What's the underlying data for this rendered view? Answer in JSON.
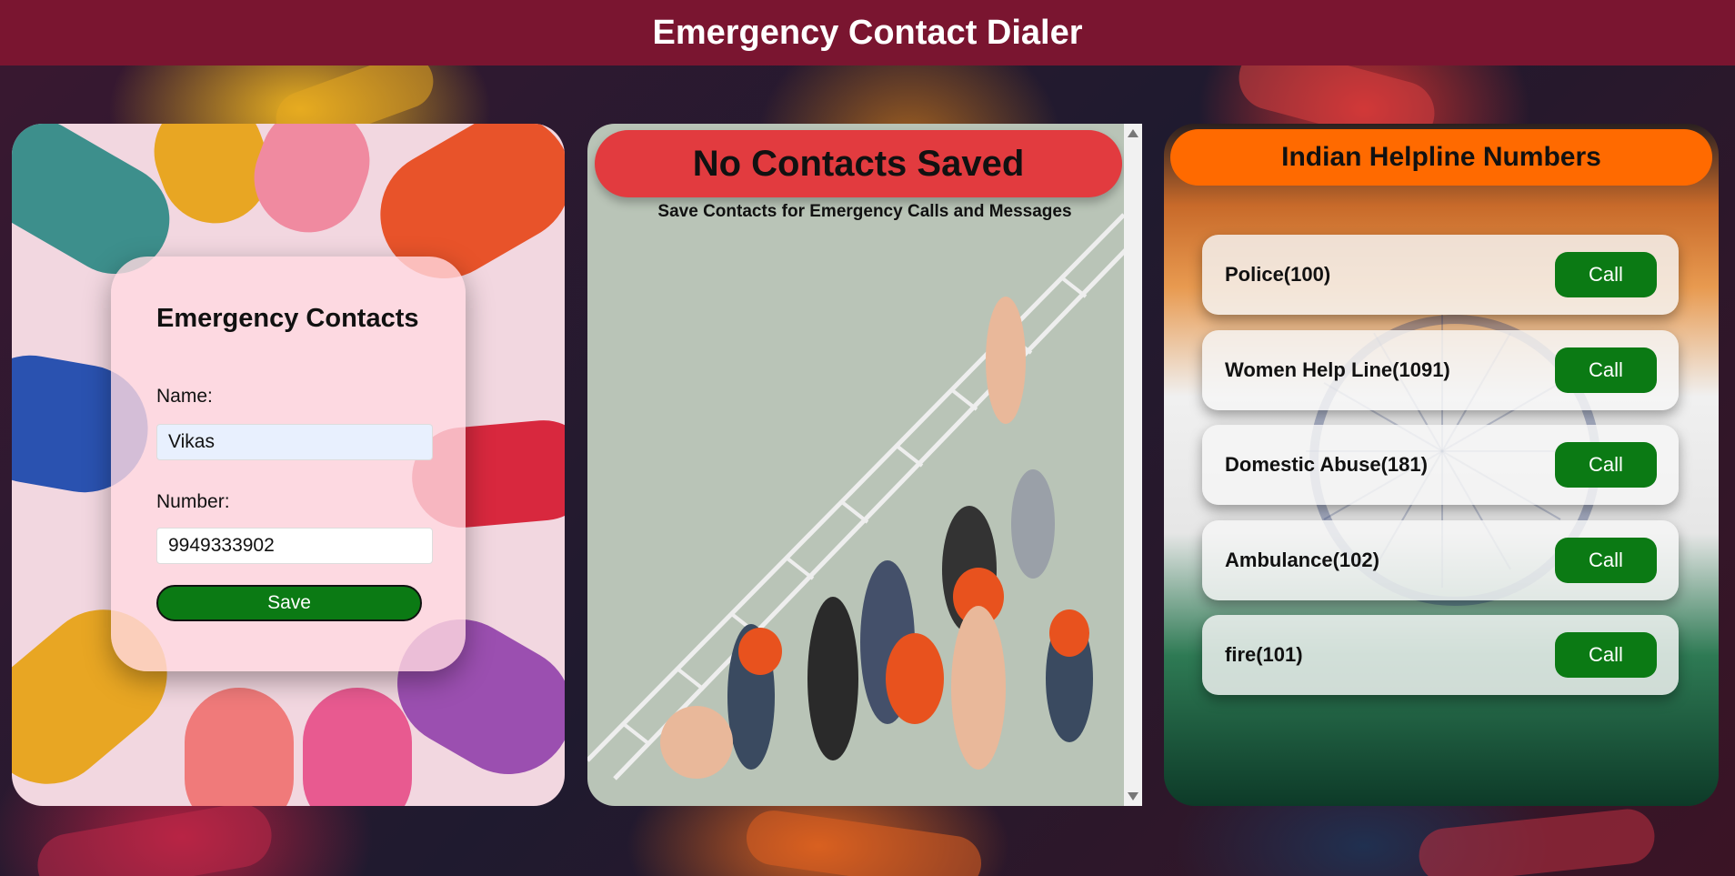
{
  "header": {
    "title": "Emergency Contact Dialer"
  },
  "form": {
    "title": "Emergency Contacts",
    "name_label": "Name:",
    "name_value": "Vikas",
    "number_label": "Number:",
    "number_value": "9949333902",
    "save_label": "Save"
  },
  "saved": {
    "title": "No Contacts Saved",
    "subtitle": "Save Contacts for Emergency Calls and Messages"
  },
  "helplines": {
    "title": "Indian Helpline Numbers",
    "items": [
      {
        "name": "Police(100)",
        "action": "Call"
      },
      {
        "name": "Women Help Line(1091)",
        "action": "Call"
      },
      {
        "name": "Domestic Abuse(181)",
        "action": "Call"
      },
      {
        "name": "Ambulance(102)",
        "action": "Call"
      },
      {
        "name": "fire(101)",
        "action": "Call"
      }
    ]
  },
  "colors": {
    "header": "#7a1530",
    "save_button": "#0b7a14",
    "call_button": "#0b7a14",
    "no_contacts_banner": "#e23b3f",
    "helpline_banner": "#ff6a00"
  }
}
